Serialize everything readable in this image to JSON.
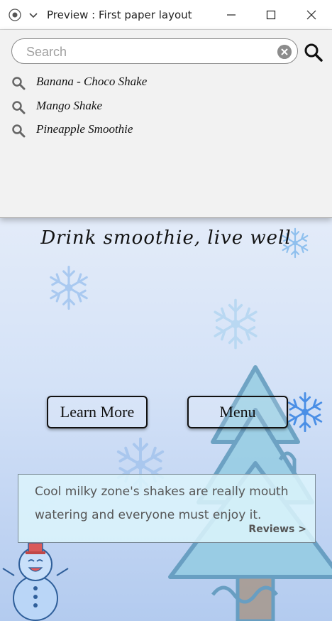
{
  "window": {
    "title": "Preview : First paper layout"
  },
  "search": {
    "placeholder": "Search",
    "value": ""
  },
  "suggestions": [
    {
      "label": "Banana - Choco Shake"
    },
    {
      "label": "Mango Shake"
    },
    {
      "label": "Pineapple Smoothie"
    }
  ],
  "hero": {
    "tagline": "Drink smoothie, live well"
  },
  "buttons": {
    "learn_more": "Learn More",
    "menu": "Menu"
  },
  "review": {
    "text": "Cool milky zone's shakes are really mouth watering and everyone must enjoy it.",
    "link": "Reviews >"
  },
  "colors": {
    "background_top": "#eef2fb",
    "background_bottom": "#b3cbef",
    "card_background": "#dcf5fc",
    "tree": "#5aa3bf",
    "snowflake": "#6aa9e6"
  },
  "icons": [
    "window-icon",
    "chevron-down-icon",
    "minimize-icon",
    "maximize-icon",
    "close-icon",
    "clear-icon",
    "search-icon",
    "snowflake-icon",
    "tree-icon",
    "snowman-icon"
  ]
}
